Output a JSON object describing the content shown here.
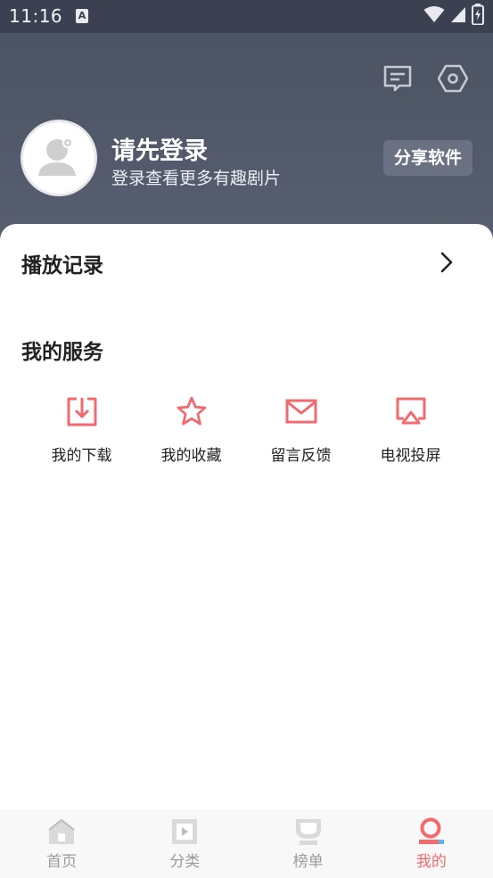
{
  "status_bar": {
    "time": "11:16",
    "notification_badge": "A"
  },
  "header": {
    "login_title": "请先登录",
    "login_subtitle": "登录查看更多有趣剧片",
    "share_label": "分享软件",
    "icons": [
      "message-icon",
      "settings-icon"
    ]
  },
  "main": {
    "history_label": "播放记录",
    "services_title": "我的服务",
    "services": [
      {
        "label": "我的下载",
        "icon": "download-icon"
      },
      {
        "label": "我的收藏",
        "icon": "star-icon"
      },
      {
        "label": "留言反馈",
        "icon": "mail-icon"
      },
      {
        "label": "电视投屏",
        "icon": "cast-icon"
      }
    ]
  },
  "bottom_nav": {
    "items": [
      {
        "label": "首页",
        "icon": "home-icon",
        "active": false
      },
      {
        "label": "分类",
        "icon": "category-icon",
        "active": false
      },
      {
        "label": "榜单",
        "icon": "ranking-icon",
        "active": false
      },
      {
        "label": "我的",
        "icon": "profile-icon",
        "active": true
      }
    ]
  },
  "colors": {
    "header_bg": "#525a6b",
    "accent": "#f26a6f",
    "nav_inactive": "#9a9a9a",
    "card_bg": "#ffffff"
  }
}
